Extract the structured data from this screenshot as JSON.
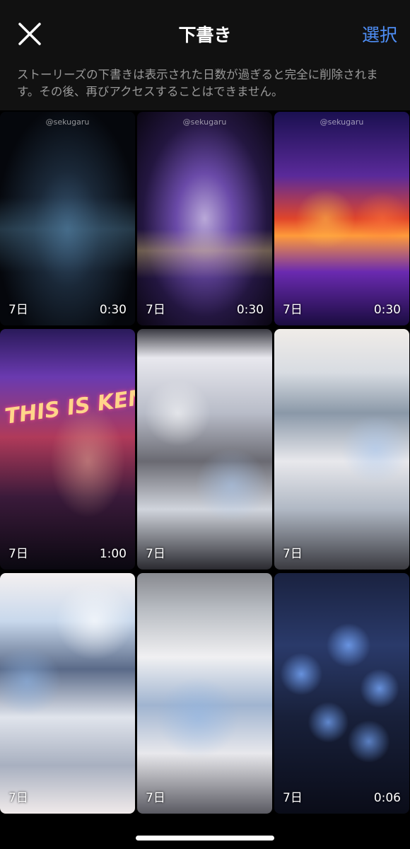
{
  "header": {
    "title": "下書き",
    "select_label": "選択",
    "close_icon": "close-icon"
  },
  "notice": "ストーリーズの下書きは表示された日数が過ぎると完全に削除されます。その後、再びアクセスすることはできません。",
  "drafts": [
    {
      "days": "7日",
      "duration": "0:30",
      "watermark": "@sekugaru"
    },
    {
      "days": "7日",
      "duration": "0:30",
      "watermark": "@sekugaru"
    },
    {
      "days": "7日",
      "duration": "0:30",
      "watermark": "@sekugaru"
    },
    {
      "days": "7日",
      "duration": "1:00",
      "title_text": "THIS IS KENTY"
    },
    {
      "days": "7日",
      "duration": ""
    },
    {
      "days": "7日",
      "duration": ""
    },
    {
      "days": "7日",
      "duration": ""
    },
    {
      "days": "7日",
      "duration": ""
    },
    {
      "days": "7日",
      "duration": "0:06"
    }
  ],
  "colors": {
    "accent": "#4f8ff7",
    "header_bg": "#111111",
    "notice_text": "#9a9a9a"
  }
}
